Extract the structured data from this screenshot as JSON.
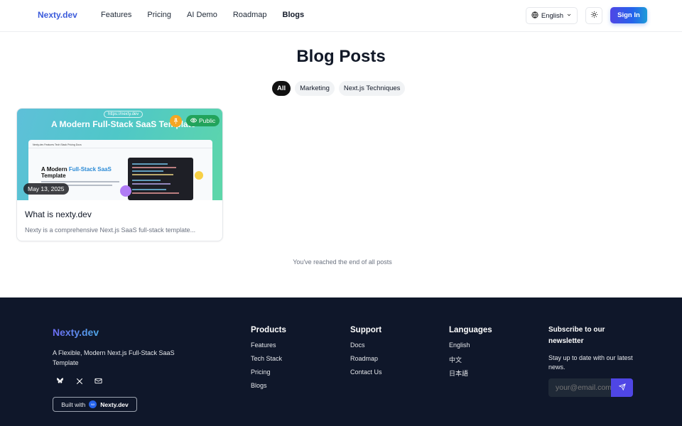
{
  "header": {
    "logo": "Nexty.dev",
    "nav": [
      "Features",
      "Pricing",
      "AI Demo",
      "Roadmap",
      "Blogs"
    ],
    "language": "English",
    "sign_in": "Sign In"
  },
  "main": {
    "title": "Blog Posts",
    "filters": [
      "All",
      "Marketing",
      "Next.js Techniques"
    ],
    "active_filter": "All",
    "posts": [
      {
        "image_url_label": "https://nexty.dev",
        "image_title": "A Modern Full-Stack SaaS Template",
        "image_hero_plain": "A Modern ",
        "image_hero_accent": "Full-Stack SaaS",
        "image_hero_line2": "Template",
        "image_nav": "Nexty.dev     Features     Tech Stack     Pricing     Docs",
        "visibility": "Public",
        "date": "May 13, 2025",
        "title": "What is nexty.dev",
        "excerpt": "Nexty is a comprehensive Next.js SaaS full-stack template..."
      }
    ],
    "end_message": "You've reached the end of all posts"
  },
  "footer": {
    "logo": "Nexty.dev",
    "tagline": "A Flexible, Modern Next.js Full-Stack SaaS Template",
    "built_with_label": "Built with",
    "built_with_brand": "Nexty.dev",
    "built_with_mark": "NX",
    "products": {
      "heading": "Products",
      "links": [
        "Features",
        "Tech Stack",
        "Pricing",
        "Blogs"
      ]
    },
    "support": {
      "heading": "Support",
      "links": [
        "Docs",
        "Roadmap",
        "Contact Us"
      ]
    },
    "languages": {
      "heading": "Languages",
      "links": [
        "English",
        "中文",
        "日本語"
      ]
    },
    "subscribe": {
      "heading": "Subscribe to our newsletter",
      "description": "Stay up to date with our latest news.",
      "placeholder": "your@email.com"
    }
  },
  "colors": {
    "brand": "#3b5bdb",
    "footer_bg": "#0f172a",
    "public_badge": "#22a35b",
    "accent_button": "#4f46e5"
  }
}
